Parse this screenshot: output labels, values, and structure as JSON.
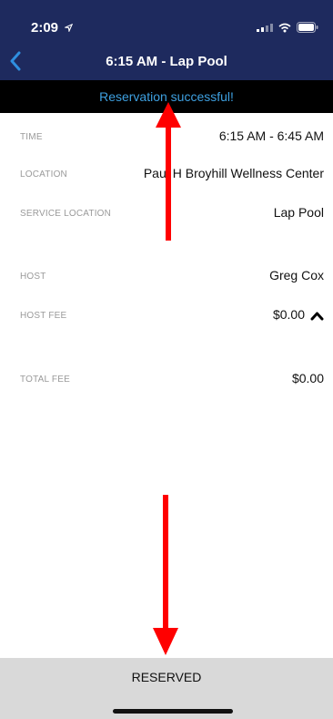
{
  "status_bar": {
    "time": "2:09",
    "location_icon": "location-arrow-icon",
    "signal_icon": "signal-icon",
    "wifi_icon": "wifi-icon",
    "battery_icon": "battery-icon"
  },
  "nav": {
    "back_icon": "chevron-left-icon",
    "title": "6:15 AM - Lap Pool"
  },
  "banner": {
    "message": "Reservation successful!"
  },
  "details": [
    {
      "label": "TIME",
      "value": "6:15 AM - 6:45 AM"
    },
    {
      "label": "LOCATION",
      "value": "Paul H Broyhill Wellness Center"
    },
    {
      "label": "SERVICE LOCATION",
      "value": "Lap Pool"
    },
    {
      "label": "HOST",
      "value": "Greg Cox"
    },
    {
      "label": "HOST FEE",
      "value": "$0.00",
      "icon": "chevron-up-icon"
    },
    {
      "label": "TOTAL FEE",
      "value": "$0.00"
    }
  ],
  "footer": {
    "button_label": "RESERVED"
  },
  "colors": {
    "header_bg": "#1e2a5e",
    "banner_bg": "#000000",
    "banner_text": "#3ea0e0",
    "footer_bg": "#d9d9d9",
    "annotation_arrow": "#ff0000"
  }
}
